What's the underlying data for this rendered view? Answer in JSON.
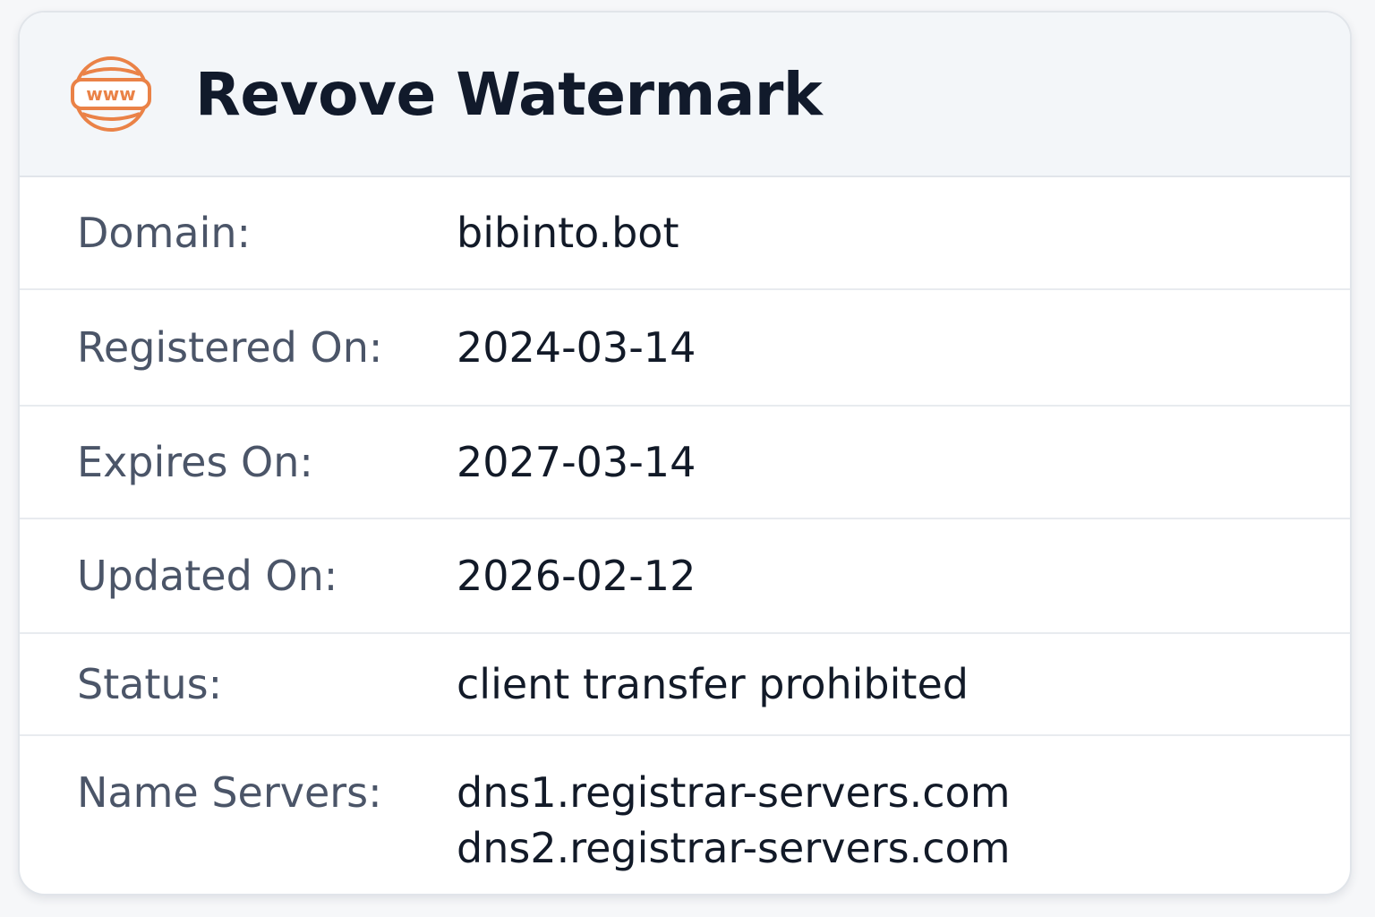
{
  "header": {
    "icon": "www-globe-icon",
    "icon_text": "www",
    "title": "Revove Watermark",
    "accent_color": "#ea8247"
  },
  "rows": [
    {
      "label": "Domain:",
      "value": "bibinto.bot"
    },
    {
      "label": "Registered On:",
      "value": "2024-03-14"
    },
    {
      "label": "Expires On:",
      "value": "2027-03-14"
    },
    {
      "label": "Updated On:",
      "value": "2026-02-12"
    },
    {
      "label": "Status:",
      "value": "client transfer prohibited"
    },
    {
      "label": "Name Servers:",
      "values": [
        "dns1.registrar-servers.com",
        "dns2.registrar-servers.com"
      ]
    }
  ]
}
